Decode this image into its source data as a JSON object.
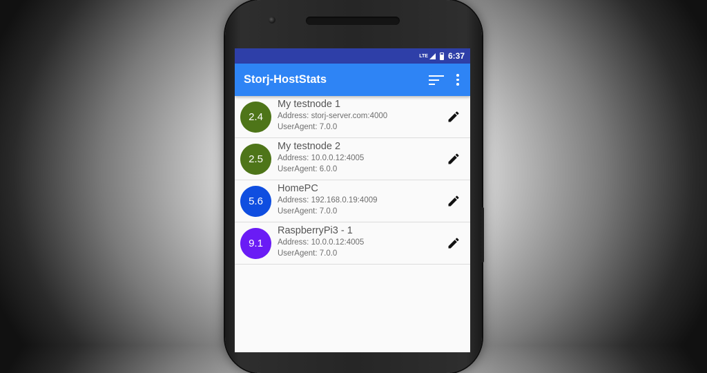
{
  "statusbar": {
    "network": "LTE",
    "battery_icon": "battery-icon",
    "time": "6:37"
  },
  "appbar": {
    "title": "Storj-HostStats",
    "sort_icon": "sort-icon",
    "more_icon": "more-vert-icon"
  },
  "nodes": [
    {
      "score": "2.4",
      "name": "My testnode 1",
      "address": "Address: storj-server.com:4000",
      "useragent": "UserAgent: 7.0.0",
      "color": "#4e7519"
    },
    {
      "score": "2.5",
      "name": "My testnode 2",
      "address": "Address: 10.0.0.12:4005",
      "useragent": "UserAgent: 6.0.0",
      "color": "#4e7519"
    },
    {
      "score": "5.6",
      "name": "HomePC",
      "address": "Address: 192.168.0.19:4009",
      "useragent": "UserAgent: 7.0.0",
      "color": "#0f4ee0"
    },
    {
      "score": "9.1",
      "name": "RaspberryPi3 - 1",
      "address": "Address: 10.0.0.12:4005",
      "useragent": "UserAgent: 7.0.0",
      "color": "#6a1cf5"
    }
  ],
  "colors": {
    "statusbar": "#2e3fa8",
    "appbar": "#2e84f5"
  }
}
